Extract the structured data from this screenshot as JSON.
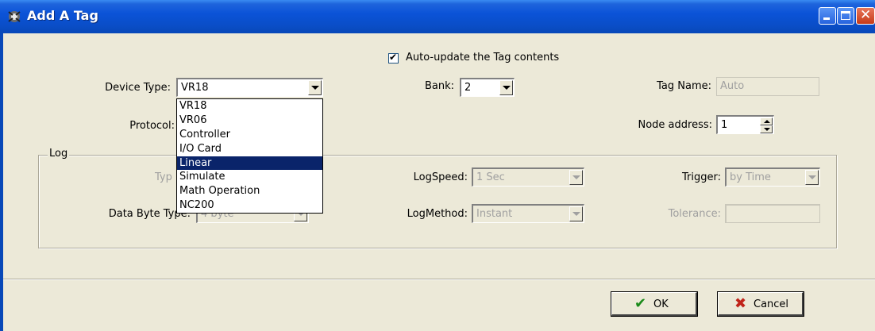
{
  "window": {
    "title": "Add A Tag"
  },
  "auto_update": {
    "label": "Auto-update the Tag contents",
    "checked": true
  },
  "device_type": {
    "label": "Device Type:",
    "value": "VR18"
  },
  "bank": {
    "label": "Bank:",
    "value": "2"
  },
  "tag_name": {
    "label": "Tag Name:",
    "value": "Auto"
  },
  "protocol": {
    "label": "Protocol:"
  },
  "node_address": {
    "label": "Node address:",
    "value": "1"
  },
  "device_dropdown": {
    "options": [
      "VR18",
      "VR06",
      "Controller",
      "I/O Card",
      "Linear",
      "Simulate",
      "Math Operation",
      "NC200"
    ],
    "highlighted": "Linear"
  },
  "log": {
    "title": "Log",
    "type_label": "Typ",
    "data_byte_type": {
      "label": "Data Byte Type:",
      "value": "4 byte"
    },
    "log_speed": {
      "label": "LogSpeed:",
      "value": "1 Sec"
    },
    "log_method": {
      "label": "LogMethod:",
      "value": "Instant"
    },
    "trigger": {
      "label": "Trigger:",
      "value": "by Time"
    },
    "tolerance": {
      "label": "Tolerance:",
      "value": ""
    }
  },
  "buttons": {
    "ok": "OK",
    "cancel": "Cancel"
  },
  "colors": {
    "titlebar": "#0848b8",
    "selection": "#0a246a",
    "ok_icon": "#1a8a1a",
    "cancel_icon": "#c0241a"
  }
}
